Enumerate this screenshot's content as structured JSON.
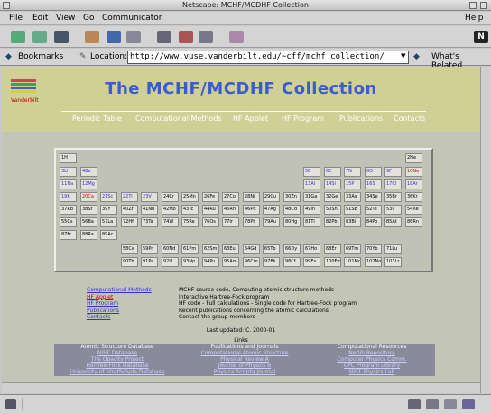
{
  "window": {
    "title": "Netscape: MCHF/MCDHF Collection"
  },
  "menu": {
    "file": "File",
    "edit": "Edit",
    "view": "View",
    "go": "Go",
    "communicator": "Communicator",
    "help": "Help"
  },
  "location": {
    "bookmarks": "Bookmarks",
    "label": "Location:",
    "url": "http://www.vuse.vanderbilt.edu/~cff/mchf_collection/",
    "whats_related": "What's Related"
  },
  "page": {
    "logo_text": "Vanderbilt",
    "title": "The MCHF/MCDHF Collection",
    "nav": [
      "Periodic Table",
      "Computational Methods",
      "HF Applet",
      "HF Program",
      "Publications",
      "Contacts"
    ],
    "cells": [
      {
        "t": "1H"
      },
      {
        "t": "2He"
      },
      {
        "t": "3Li",
        "c": "link"
      },
      {
        "t": "4Be",
        "c": "link"
      },
      {
        "t": "5B",
        "c": "link"
      },
      {
        "t": "6C",
        "c": "link"
      },
      {
        "t": "7N",
        "c": "link"
      },
      {
        "t": "8O",
        "c": "link"
      },
      {
        "t": "9F",
        "c": "link"
      },
      {
        "t": "10Ne",
        "c": "red"
      },
      {
        "t": "11Na",
        "c": "link"
      },
      {
        "t": "12Mg",
        "c": "link"
      },
      {
        "t": "13Al",
        "c": "link"
      },
      {
        "t": "14Si",
        "c": "link"
      },
      {
        "t": "15P",
        "c": "link"
      },
      {
        "t": "16S",
        "c": "link"
      },
      {
        "t": "17Cl",
        "c": "link"
      },
      {
        "t": "18Ar",
        "c": "link"
      },
      {
        "t": "19K",
        "c": "link"
      },
      {
        "t": "20Ca",
        "c": "red"
      },
      {
        "t": "21Sc",
        "c": "link"
      },
      {
        "t": "22Ti",
        "c": "link"
      },
      {
        "t": "23V",
        "c": "link"
      },
      {
        "t": "24Cr"
      },
      {
        "t": "25Mn"
      },
      {
        "t": "26Fe"
      },
      {
        "t": "27Co"
      },
      {
        "t": "28Ni"
      },
      {
        "t": "29Cu"
      },
      {
        "t": "30Zn"
      },
      {
        "t": "31Ga"
      },
      {
        "t": "32Ge"
      },
      {
        "t": "33As"
      },
      {
        "t": "34Se"
      },
      {
        "t": "35Br"
      },
      {
        "t": "36Kr"
      },
      {
        "t": "37Rb"
      },
      {
        "t": "38Sr"
      },
      {
        "t": "39Y"
      },
      {
        "t": "40Zr"
      },
      {
        "t": "41Nb"
      },
      {
        "t": "42Mo"
      },
      {
        "t": "43Tc"
      },
      {
        "t": "44Ru"
      },
      {
        "t": "45Rh"
      },
      {
        "t": "46Pd"
      },
      {
        "t": "47Ag"
      },
      {
        "t": "48Cd"
      },
      {
        "t": "49In"
      },
      {
        "t": "50Sn"
      },
      {
        "t": "51Sb"
      },
      {
        "t": "52Te"
      },
      {
        "t": "53I"
      },
      {
        "t": "54Xe"
      },
      {
        "t": "55Cs"
      },
      {
        "t": "56Ba"
      },
      {
        "t": "57La"
      },
      {
        "t": "72Hf"
      },
      {
        "t": "73Ta"
      },
      {
        "t": "74W"
      },
      {
        "t": "75Re"
      },
      {
        "t": "76Os"
      },
      {
        "t": "77Ir"
      },
      {
        "t": "78Pt"
      },
      {
        "t": "79Au"
      },
      {
        "t": "80Hg"
      },
      {
        "t": "81Tl"
      },
      {
        "t": "82Pb"
      },
      {
        "t": "83Bi"
      },
      {
        "t": "84Po"
      },
      {
        "t": "85At"
      },
      {
        "t": "86Rn"
      },
      {
        "t": "87Fr"
      },
      {
        "t": "88Ra"
      },
      {
        "t": "89Ac"
      },
      {
        "t": "58Ce"
      },
      {
        "t": "59Pr"
      },
      {
        "t": "60Nd"
      },
      {
        "t": "61Pm"
      },
      {
        "t": "62Sm"
      },
      {
        "t": "63Eu"
      },
      {
        "t": "64Gd"
      },
      {
        "t": "65Tb"
      },
      {
        "t": "66Dy"
      },
      {
        "t": "67Ho"
      },
      {
        "t": "68Er"
      },
      {
        "t": "69Tm"
      },
      {
        "t": "70Yb"
      },
      {
        "t": "71Lu"
      },
      {
        "t": "90Th"
      },
      {
        "t": "91Pa"
      },
      {
        "t": "92U"
      },
      {
        "t": "93Np"
      },
      {
        "t": "94Pu"
      },
      {
        "t": "95Am"
      },
      {
        "t": "96Cm"
      },
      {
        "t": "97Bk"
      },
      {
        "t": "98Cf"
      },
      {
        "t": "99Es"
      },
      {
        "t": "100Fm"
      },
      {
        "t": "101Md"
      },
      {
        "t": "102No"
      },
      {
        "t": "103Lr"
      }
    ],
    "info_left": [
      "Computational Methods",
      "HF Applet",
      "HF Program",
      "Publications",
      "Contacts"
    ],
    "info_right": [
      "MCHF source code, Computing atomic structure methods",
      "Interactive Hartree-Fock program",
      "HF code - Full calculations - Single code for Hartree-Fock program",
      "Recent publications concerning the atomic calculations",
      "Contact the group members"
    ],
    "last_updated": "Last updated: C. 2000-01",
    "links_label": "Links",
    "resources": [
      {
        "head": "Atomic Structure Database",
        "items": [
          "NIST Database",
          "The Opacity Project",
          "Hartree-Fock Database",
          "University of Strathclyde Database"
        ]
      },
      {
        "head": "Publications and Journals",
        "items": [
          "Computational Atomic Structure",
          "Physical Review A",
          "Journal of Physics B",
          "Physica Scripta Journal"
        ]
      },
      {
        "head": "Computational Resources",
        "items": [
          "Netlib Repository",
          "Computer Physics Comm.",
          "CPC Program Library",
          "NIST Physics Lab"
        ]
      }
    ]
  }
}
